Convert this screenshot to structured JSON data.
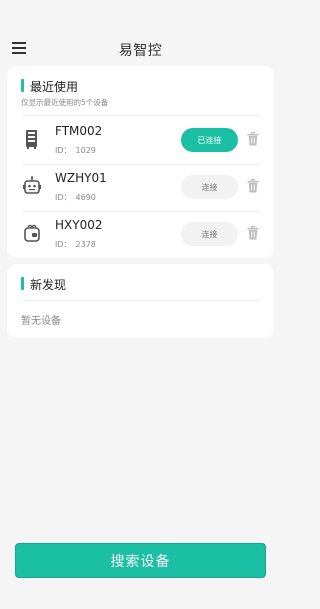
{
  "header": {
    "title": "易智控"
  },
  "recent": {
    "title": "最近使用",
    "subtitle": "仅显示最近使用的5个设备",
    "devices": [
      {
        "name": "FTM002",
        "id_label": "ID：",
        "id": "1029",
        "icon": "cabinet-icon",
        "action": "已连接",
        "connected": true
      },
      {
        "name": "WZHY01",
        "id_label": "ID：",
        "id": "4690",
        "icon": "robot-icon",
        "action": "连接",
        "connected": false
      },
      {
        "name": "HXY002",
        "id_label": "ID：",
        "id": "2378",
        "icon": "box-icon",
        "action": "连接",
        "connected": false
      }
    ]
  },
  "discovered": {
    "title": "新发现",
    "empty_text": "暂无设备"
  },
  "footer": {
    "search_label": "搜索设备"
  },
  "colors": {
    "accent": "#1bbfa3",
    "background": "#f5f5f5"
  }
}
